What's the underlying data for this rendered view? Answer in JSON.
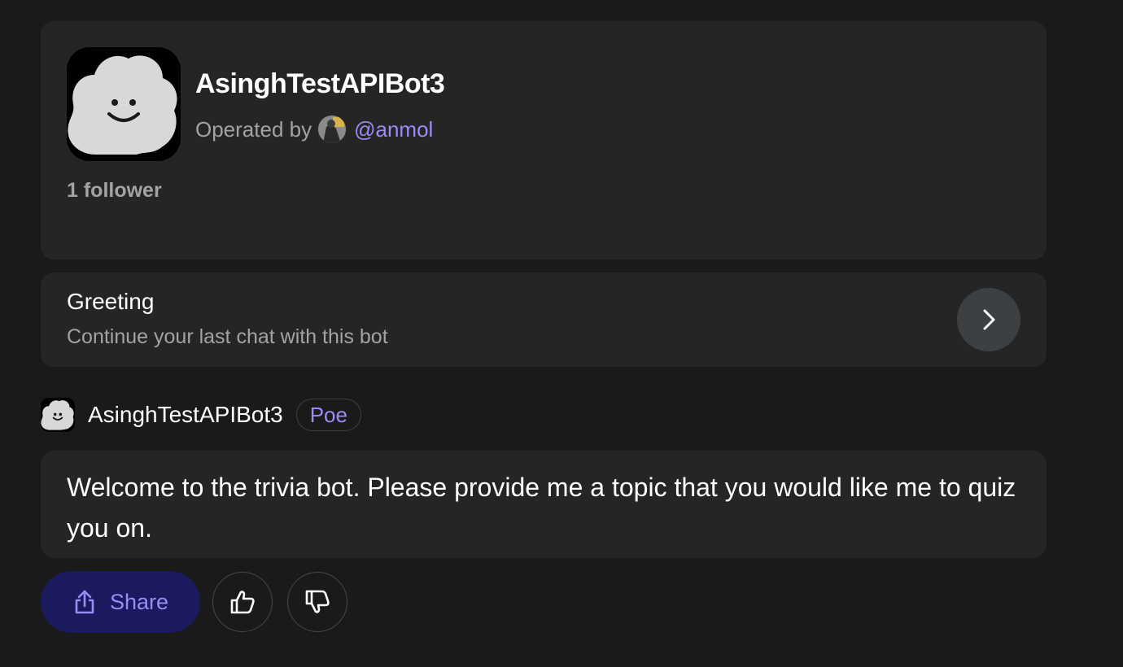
{
  "bot": {
    "name": "AsinghTestAPIBot3",
    "operated_by_label": "Operated by",
    "operator_handle": "@anmol",
    "followers": "1 follower"
  },
  "greeting": {
    "title": "Greeting",
    "subtitle": "Continue your last chat with this bot"
  },
  "message": {
    "sender": "AsinghTestAPIBot3",
    "badge": "Poe",
    "text": "Welcome to the trivia bot. Please provide me a topic that you would like me to quiz you on."
  },
  "actions": {
    "share_label": "Share"
  },
  "icons": {
    "bot_avatar": "cloud-face-icon",
    "operator_avatar": "user-avatar-icon",
    "chevron": "chevron-right-icon",
    "share": "share-icon",
    "like": "thumbs-up-icon",
    "dislike": "thumbs-down-icon"
  },
  "colors": {
    "background": "#1a1a1a",
    "card": "#252525",
    "accent": "#9a8cf5",
    "share_bg": "#1b1a5e",
    "muted_text": "#a3a3a3"
  }
}
